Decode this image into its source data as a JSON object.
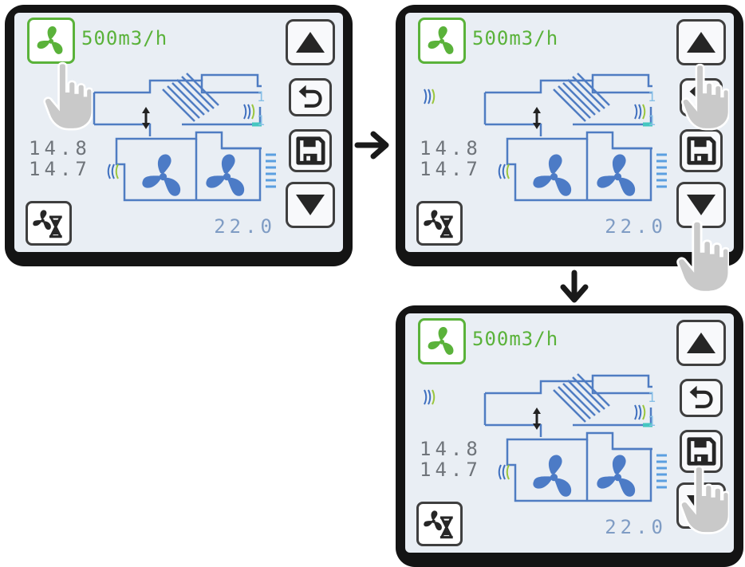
{
  "panels": [
    {
      "flow": "500m3/h",
      "temp_outdoor": "14.8",
      "temp_extract": "14.7",
      "temp_supply": "22.0",
      "level_top": "1",
      "level_bottom": "1",
      "touch": "fan-button"
    },
    {
      "flow": "500m3/h",
      "temp_outdoor": "14.8",
      "temp_extract": "14.7",
      "temp_supply": "22.0",
      "level_top": "1",
      "level_bottom": "1",
      "touch": "up-and-down-buttons"
    },
    {
      "flow": "500m3/h",
      "temp_outdoor": "14.8",
      "temp_extract": "14.7",
      "temp_supply": "22.0",
      "level_top": "1",
      "level_bottom": "1",
      "touch": "save-button"
    }
  ],
  "icons": {
    "fan": "fan-icon",
    "timer": "fan-timer-icon",
    "up": "triangle-up-icon",
    "back": "undo-arrow-icon",
    "save": "floppy-disk-icon",
    "down": "triangle-down-icon",
    "hand": "pointing-hand-icon",
    "step_arrow": "arrow-icon"
  },
  "colors": {
    "accent_green": "#5ab23a",
    "duct_blue": "#4f7cc2",
    "fan_blue": "#4c7bc6",
    "screen_bg": "#e9eef4",
    "bezel": "#141414"
  }
}
